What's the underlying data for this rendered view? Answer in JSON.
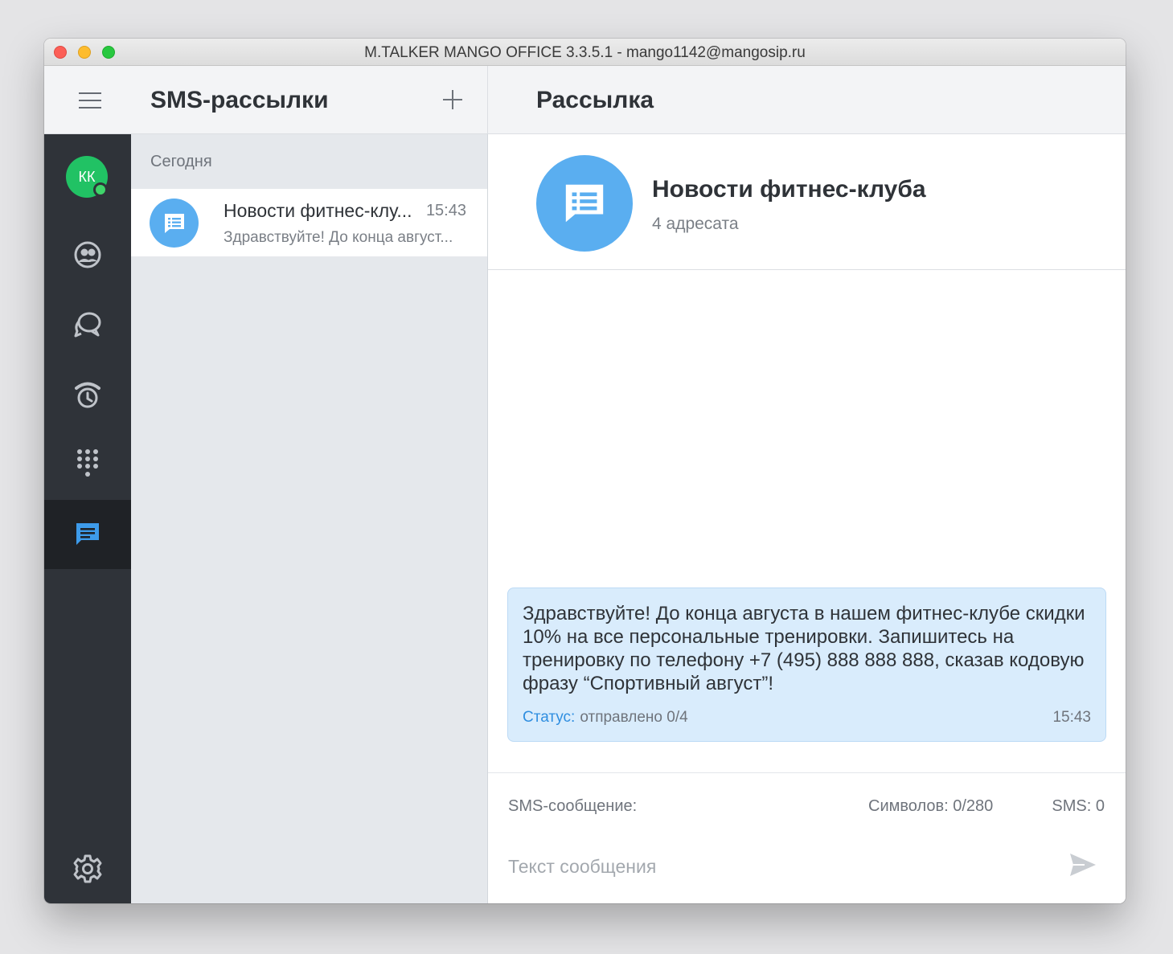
{
  "window": {
    "title": "M.TALKER MANGO OFFICE 3.3.5.1 - mango1142@mangosip.ru"
  },
  "header": {
    "section_title": "SMS-рассылки",
    "detail_title": "Рассылка"
  },
  "rail": {
    "avatar_initials": "КК",
    "items": [
      "user-circle-icon",
      "chat-bubbles-icon",
      "alarm-phone-icon",
      "dialpad-icon",
      "sms-icon"
    ],
    "active_item": "sms-icon",
    "bottom_item": "gear-icon",
    "accent_color": "#3d9bea"
  },
  "list": {
    "group_header": "Сегодня",
    "items": [
      {
        "title": "Новости фитнес-клу...",
        "time": "15:43",
        "preview": "Здравствуйте! До конца август..."
      }
    ]
  },
  "detail": {
    "name": "Новости фитнес-клуба",
    "recipients": "4 адресата",
    "message": {
      "text": "Здравствуйте! До конца августа в нашем фитнес-клубе скидки 10% на все персональные тренировки. Запишитесь на тренировку по телефону +7 (495) 888 888 888, сказав кодовую фразу “Спортивный август”!",
      "status_label": "Статус:",
      "status_value": "отправлено 0/4",
      "time": "15:43"
    }
  },
  "composer": {
    "label": "SMS-сообщение:",
    "chars": "Символов: 0/280",
    "sms_count": "SMS: 0",
    "placeholder": "Текст сообщения",
    "value": ""
  }
}
